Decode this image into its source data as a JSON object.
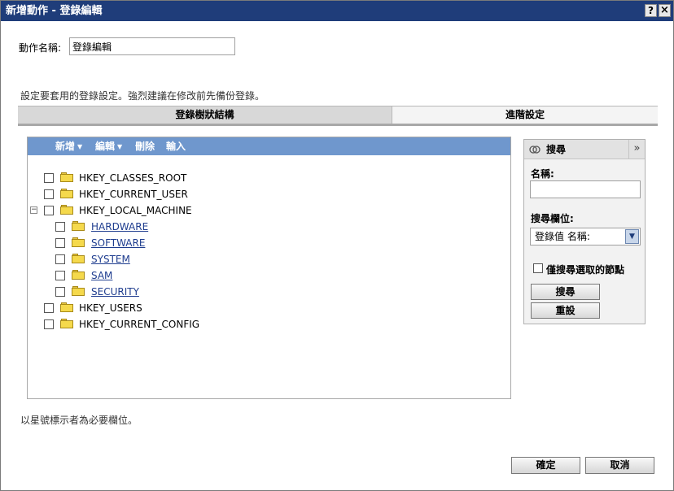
{
  "window": {
    "title": "新增動作 - 登錄編輯",
    "help_label": "?",
    "close_label": "×"
  },
  "form": {
    "name_label": "動作名稱:",
    "name_value": "登錄編輯",
    "description": "設定要套用的登錄設定。強烈建議在修改前先備份登錄。"
  },
  "tabs": [
    {
      "label": "登錄樹狀結構",
      "active": true
    },
    {
      "label": "進階設定",
      "active": false
    }
  ],
  "tree_toolbar": {
    "add": "新增",
    "edit": "編輯",
    "delete": "刪除",
    "import": "輸入"
  },
  "tree": {
    "nodes": [
      {
        "label": "HKEY_CLASSES_ROOT",
        "level": 0,
        "link": false
      },
      {
        "label": "HKEY_CURRENT_USER",
        "level": 0,
        "link": false
      },
      {
        "label": "HKEY_LOCAL_MACHINE",
        "level": 0,
        "link": false,
        "expanded": true
      },
      {
        "label": "HARDWARE",
        "level": 1,
        "link": true
      },
      {
        "label": "SOFTWARE",
        "level": 1,
        "link": true
      },
      {
        "label": "SYSTEM",
        "level": 1,
        "link": true
      },
      {
        "label": "SAM",
        "level": 1,
        "link": true
      },
      {
        "label": "SECURITY",
        "level": 1,
        "link": true
      },
      {
        "label": "HKEY_USERS",
        "level": 0,
        "link": false
      },
      {
        "label": "HKEY_CURRENT_CONFIG",
        "level": 0,
        "link": false
      }
    ],
    "expander_symbol": "−"
  },
  "search": {
    "title": "搜尋",
    "collapse_symbol": "»",
    "name_label": "名稱:",
    "name_value": "",
    "field_label": "搜尋欄位:",
    "field_selected": "登錄值 名稱:",
    "only_selected_label": "僅搜尋選取的節點",
    "search_button": "搜尋",
    "reset_button": "重設"
  },
  "required_note": "以星號標示者為必要欄位。",
  "footer": {
    "ok": "確定",
    "cancel": "取消"
  },
  "colors": {
    "titlebar": "#1f3d7a",
    "toolbar": "#6f97cd",
    "link": "#1f3d8f",
    "folder": "#f5d94c"
  }
}
